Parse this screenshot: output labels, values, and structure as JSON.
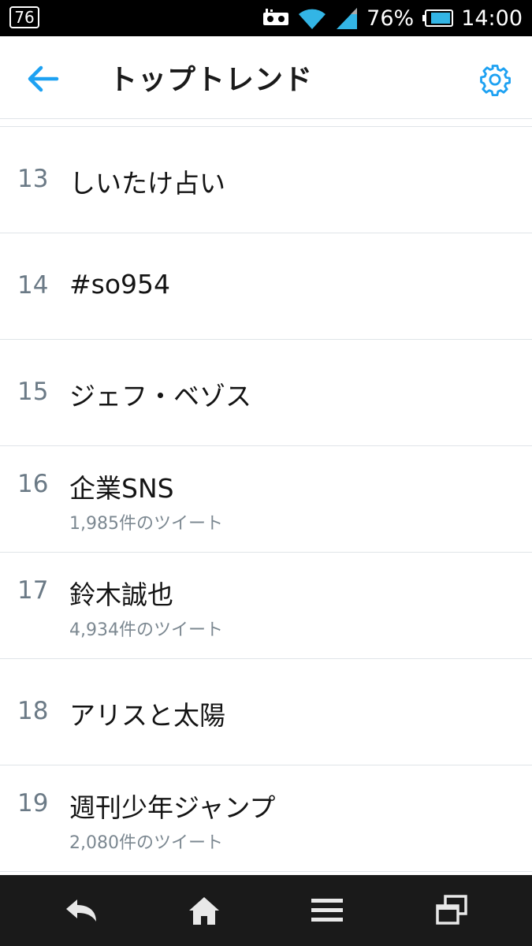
{
  "status_bar": {
    "notification_count": "76",
    "battery_percent": "76%",
    "time": "14:00",
    "icons": [
      "voicemail-icon",
      "wifi-icon",
      "signal-icon",
      "battery-icon"
    ]
  },
  "header": {
    "title": "トップトレンド",
    "back_icon": "arrow-left-icon",
    "settings_icon": "gear-icon",
    "accent_color": "#1da1f2"
  },
  "trends": [
    {
      "rank": "13",
      "name": "しいたけ占い",
      "tweets": ""
    },
    {
      "rank": "14",
      "name": "#so954",
      "tweets": ""
    },
    {
      "rank": "15",
      "name": "ジェフ・ベゾス",
      "tweets": ""
    },
    {
      "rank": "16",
      "name": "企業SNS",
      "tweets": "1,985件のツイート"
    },
    {
      "rank": "17",
      "name": "鈴木誠也",
      "tweets": "4,934件のツイート"
    },
    {
      "rank": "18",
      "name": "アリスと太陽",
      "tweets": ""
    },
    {
      "rank": "19",
      "name": "週刊少年ジャンプ",
      "tweets": "2,080件のツイート"
    }
  ],
  "nav_bar": {
    "icons": [
      "back-icon",
      "home-icon",
      "menu-icon",
      "recent-apps-icon"
    ]
  }
}
